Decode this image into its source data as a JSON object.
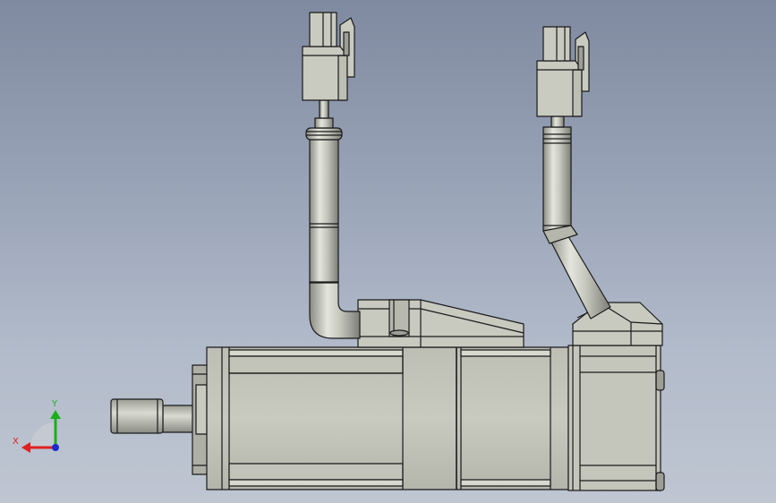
{
  "viewport": {
    "background_top": "#7f8aa0",
    "background_bottom": "#bfc6d2"
  },
  "model": {
    "name": "servo-motor-with-cables",
    "body_color": "#c4c5bb",
    "edge_color": "#1a1a1a",
    "shade_color": "#8e8f86"
  },
  "triad": {
    "x_label": "X",
    "y_label": "Y",
    "x_color": "#e02020",
    "y_color": "#19b019",
    "z_color": "#1a2bd0"
  }
}
